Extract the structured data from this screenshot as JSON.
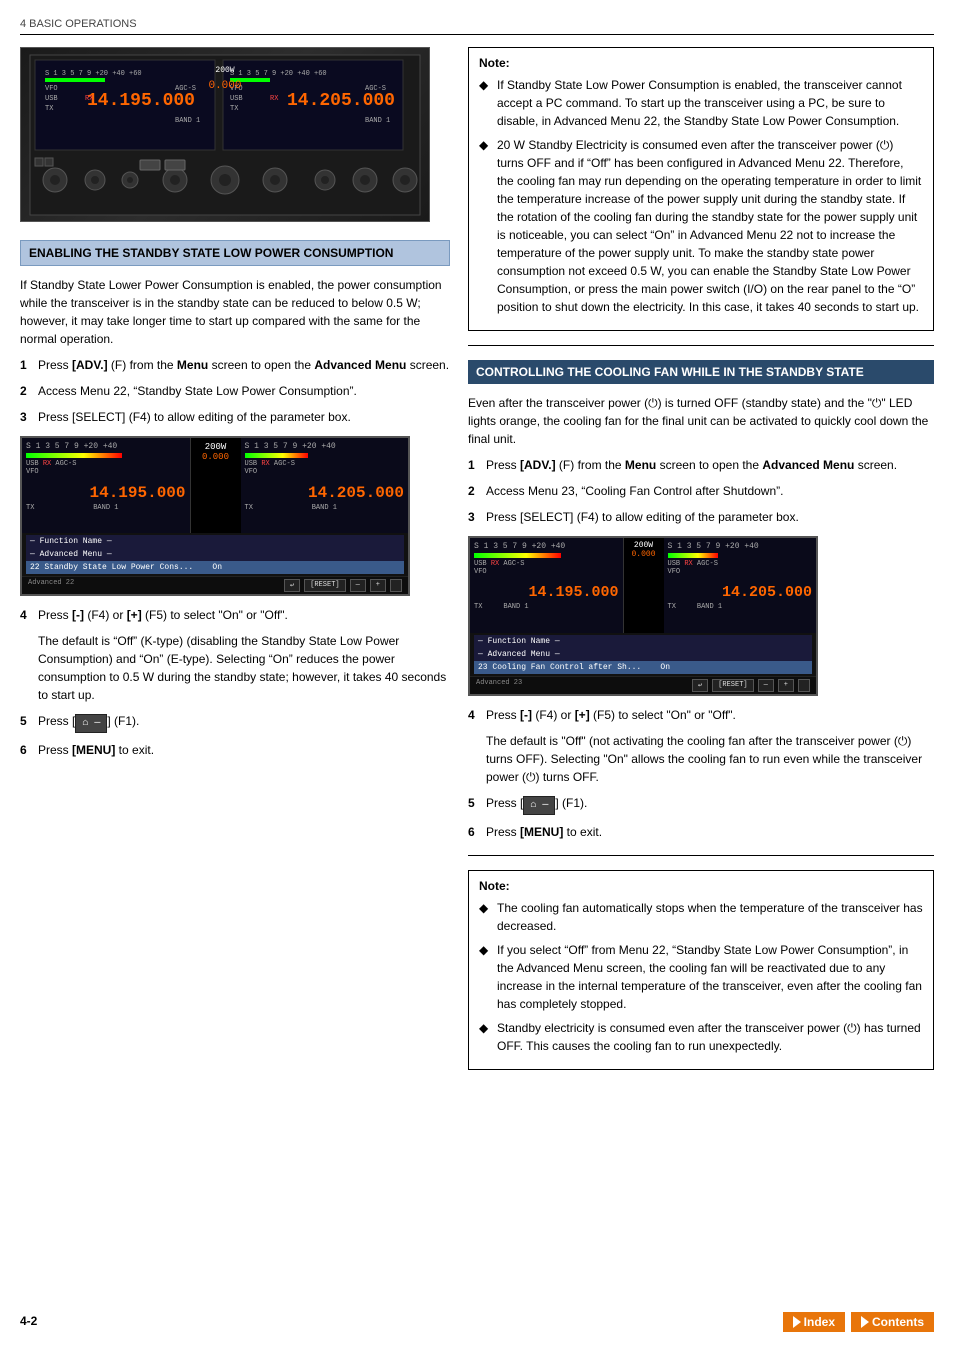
{
  "header": {
    "text": "4 BASIC OPERATIONS"
  },
  "page_num": "4-2",
  "left_section": {
    "title": "ENABLING THE STANDBY STATE LOW POWER CONSUMPTION",
    "intro": "If Standby State Lower Power Consumption is enabled, the power consumption while the transceiver is in the standby state can be reduced to below 0.5 W; however, it may take longer time to start up compared with the same for the normal operation.",
    "steps": [
      {
        "num": "1",
        "text": "Press [ADV.] (F) from the Menu screen to open the Advanced Menu screen."
      },
      {
        "num": "2",
        "text": "Access Menu 22, “Standby State Low Power Consumption”."
      },
      {
        "num": "3",
        "text": "Press [SELECT] (F4) to allow editing of the parameter box."
      },
      {
        "num": "4",
        "text": "Press [-] (F4) or [+] (F5) to select “On” or “Off”.",
        "sub": "The default is “Off” (K-type) (disabling the Standby State Low Power Consumption) and “On” (E-type). Selecting “On” reduces the power consumption to 0.5 W during the standby state; however, it takes 40 seconds to start up."
      },
      {
        "num": "5",
        "text": "Press [     ] (F1)."
      },
      {
        "num": "6",
        "text": "Press [MENU] to exit."
      }
    ],
    "screen": {
      "freq_left": "14.195.000",
      "freq_right": "14.205.000",
      "menu_label": "Advanced Menu",
      "menu_item": "22 Standby State Low Power Cons...",
      "menu_value": "On",
      "advanced_num": "Advanced 22",
      "footer_btns": [
        "[RESET]",
        "—",
        "+"
      ]
    }
  },
  "right_note": {
    "title": "Note:",
    "items": [
      "If Standby State Low Power Consumption is enabled, the transceiver cannot accept a PC command. To start up the transceiver using a PC, be sure to disable, in Advanced Menu 22, the Standby State Low Power Consumption.",
      "20 W Standby Electricity is consumed even after the transceiver power (⏻) turns OFF and if “Off” has been configured in Advanced Menu 22. Therefore, the cooling fan may run depending on the operating temperature in order to limit the temperature increase of the power supply unit during the standby state. If the rotation of the cooling fan during the standby state for the power supply unit is noticeable, you can select “On” in Advanced Menu 22 not to increase the temperature of the power supply unit. To make the standby state power consumption not exceed 0.5 W, you can enable the Standby State Low Power Consumption, or press the main power switch (I/O) on the rear panel to the “O” position to shut down the electricity. In this case, it takes 40 seconds to start up."
    ]
  },
  "right_section": {
    "title": "CONTROLLING THE COOLING FAN WHILE IN THE STANDBY STATE",
    "intro": "Even after the transceiver power (⏻) is turned OFF (standby state) and the “⏻” LED lights orange, the cooling fan for the final unit can be activated to quickly cool down the final unit.",
    "steps": [
      {
        "num": "1",
        "text": "Press [ADV.] (F) from the Menu screen to open the Advanced Menu screen."
      },
      {
        "num": "2",
        "text": "Access Menu 23, “Cooling Fan Control after Shutdown”."
      },
      {
        "num": "3",
        "text": "Press [SELECT] (F4) to allow editing of the parameter box."
      },
      {
        "num": "4",
        "text": "Press [-] (F4) or [+] (F5) to select “On” or “Off”.",
        "sub": "The default is “Off” (not activating the cooling fan after the transceiver power (⏻) turns OFF). Selecting “On” allows the cooling fan to run even while the transceiver power (⏻) turns OFF."
      },
      {
        "num": "5",
        "text": "Press [     ] (F1)."
      },
      {
        "num": "6",
        "text": "Press [MENU] to exit."
      }
    ],
    "screen": {
      "freq_left": "14.195.000",
      "freq_right": "14.205.000",
      "menu_label": "Advanced Menu",
      "menu_item": "23 Cooling Fan Control after Sh...",
      "menu_value": "On",
      "advanced_num": "Advanced 23",
      "footer_btns": [
        "[RESET]",
        "—",
        "+"
      ]
    }
  },
  "right_note2": {
    "title": "Note:",
    "items": [
      "The cooling fan automatically stops when the temperature of the transceiver has decreased.",
      "If you select “Off” from Menu 22, “Standby State Low Power Consumption”, in the Advanced Menu screen, the cooling fan will be reactivated due to any increase in the internal temperature of the transceiver, even after the cooling fan has completely stopped.",
      "Standby electricity is consumed even after the transceiver power (⏻) has turned OFF. This causes the cooling fan to run unexpectedly."
    ]
  },
  "nav": {
    "index_label": "Index",
    "contents_label": "Contents"
  }
}
